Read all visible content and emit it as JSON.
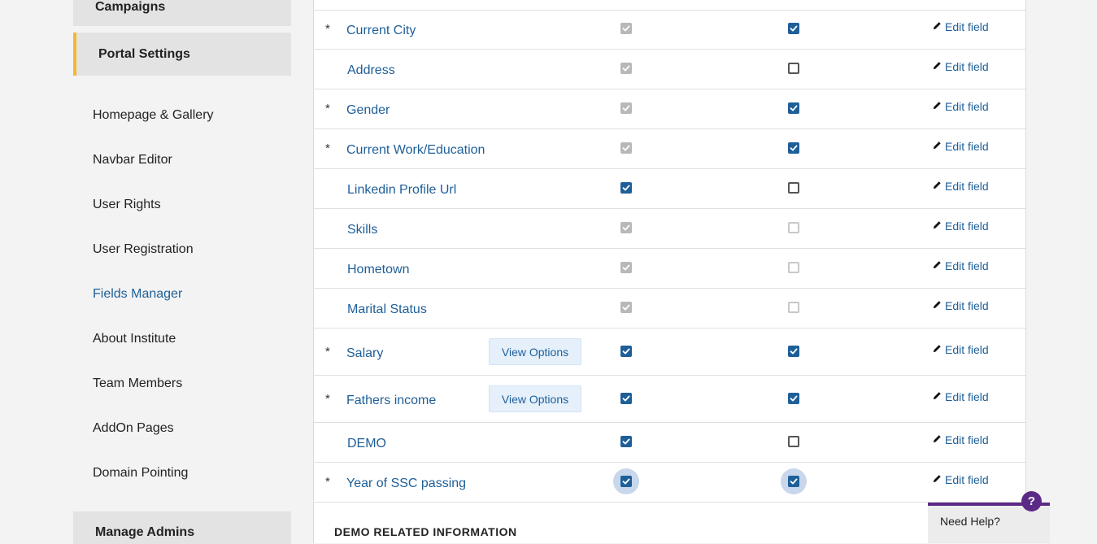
{
  "sidebar": {
    "campaigns": "Campaigns",
    "portal_settings": "Portal Settings",
    "items": [
      {
        "label": "Homepage & Gallery"
      },
      {
        "label": "Navbar Editor"
      },
      {
        "label": "User Rights"
      },
      {
        "label": "User Registration"
      },
      {
        "label": "Fields Manager",
        "active": true
      },
      {
        "label": "About Institute"
      },
      {
        "label": "Team Members"
      },
      {
        "label": "AddOn Pages"
      },
      {
        "label": "Domain Pointing"
      }
    ],
    "manage_admins": "Manage Admins"
  },
  "fields": {
    "required_marker": "*",
    "edit_label": "Edit field",
    "view_options_label": "View Options",
    "rows": [
      {
        "name": "Current City",
        "required": true,
        "col1": "checked-disabled",
        "col2": "checked"
      },
      {
        "name": "Address",
        "required": false,
        "col1": "checked-disabled",
        "col2": "unchecked"
      },
      {
        "name": "Gender",
        "required": true,
        "col1": "checked-disabled",
        "col2": "checked"
      },
      {
        "name": "Current Work/Education",
        "required": true,
        "col1": "checked-disabled",
        "col2": "checked"
      },
      {
        "name": "Linkedin Profile Url",
        "required": false,
        "col1": "checked",
        "col2": "unchecked"
      },
      {
        "name": "Skills",
        "required": false,
        "col1": "checked-disabled",
        "col2": "unchecked-disabled"
      },
      {
        "name": "Hometown",
        "required": false,
        "col1": "checked-disabled",
        "col2": "unchecked-disabled"
      },
      {
        "name": "Marital Status",
        "required": false,
        "col1": "checked-disabled",
        "col2": "unchecked-disabled"
      },
      {
        "name": "Salary",
        "required": true,
        "col1": "checked",
        "col2": "checked",
        "view_options": true
      },
      {
        "name": "Fathers income",
        "required": true,
        "col1": "checked",
        "col2": "checked",
        "view_options": true
      },
      {
        "name": "DEMO",
        "required": false,
        "col1": "checked",
        "col2": "unchecked"
      },
      {
        "name": "Year of SSC passing",
        "required": true,
        "col1": "checked",
        "col2": "checked",
        "focused": true
      }
    ]
  },
  "next_section_heading": "DEMO RELATED INFORMATION",
  "help": {
    "label": "Need Help?",
    "icon_text": "?"
  },
  "colors": {
    "accent": "#1e5f99",
    "portal_marker": "#f5b731",
    "help_brand": "#5b2a86"
  }
}
